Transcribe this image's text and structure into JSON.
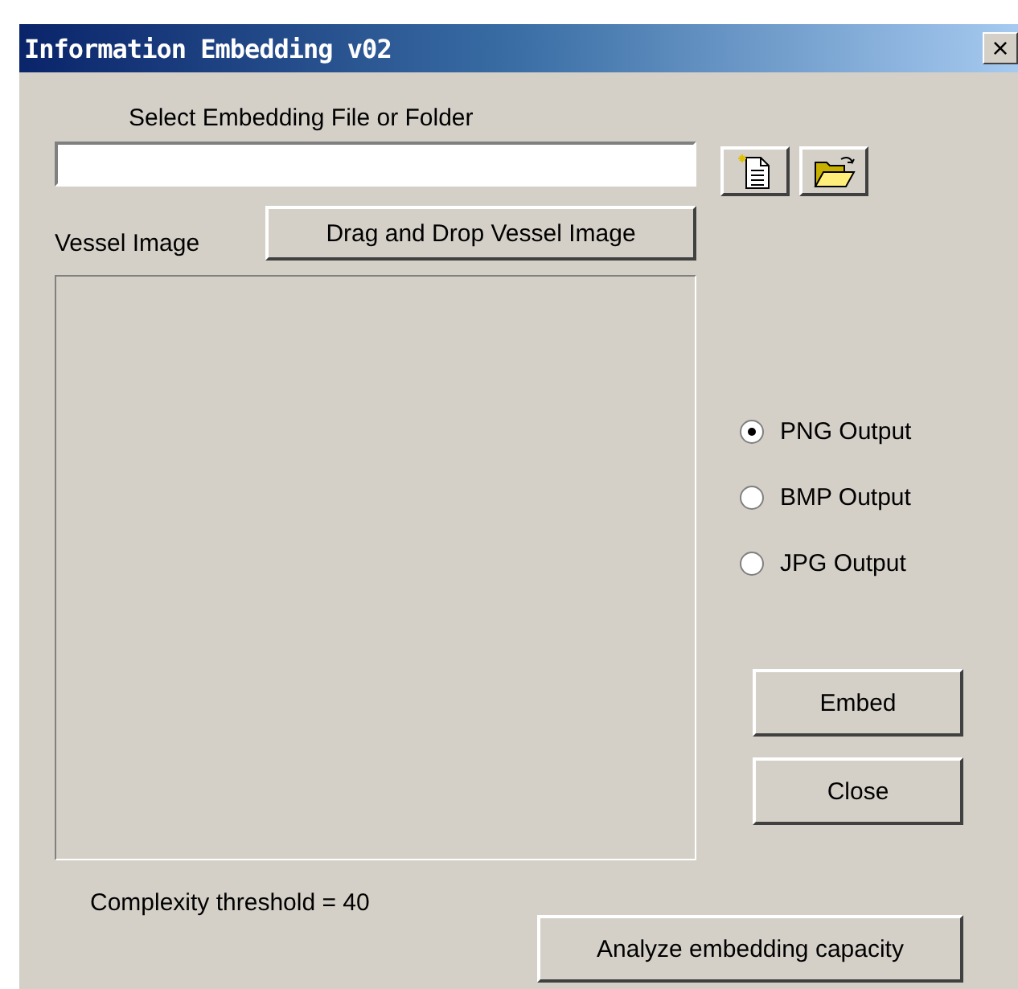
{
  "window": {
    "title": "Information Embedding v02",
    "close": "×"
  },
  "file_label": "Select Embedding File or Folder",
  "vessel_label": "Vessel Image",
  "drop_button": "Drag and Drop Vessel Image",
  "outputs": [
    {
      "label": "PNG Output",
      "selected": true
    },
    {
      "label": "BMP Output",
      "selected": false
    },
    {
      "label": "JPG Output",
      "selected": false
    }
  ],
  "buttons": [
    "Embed",
    "Close"
  ],
  "threshold": "Complexity threshold = 40",
  "analyze_button": "Analyze embedding capacity"
}
